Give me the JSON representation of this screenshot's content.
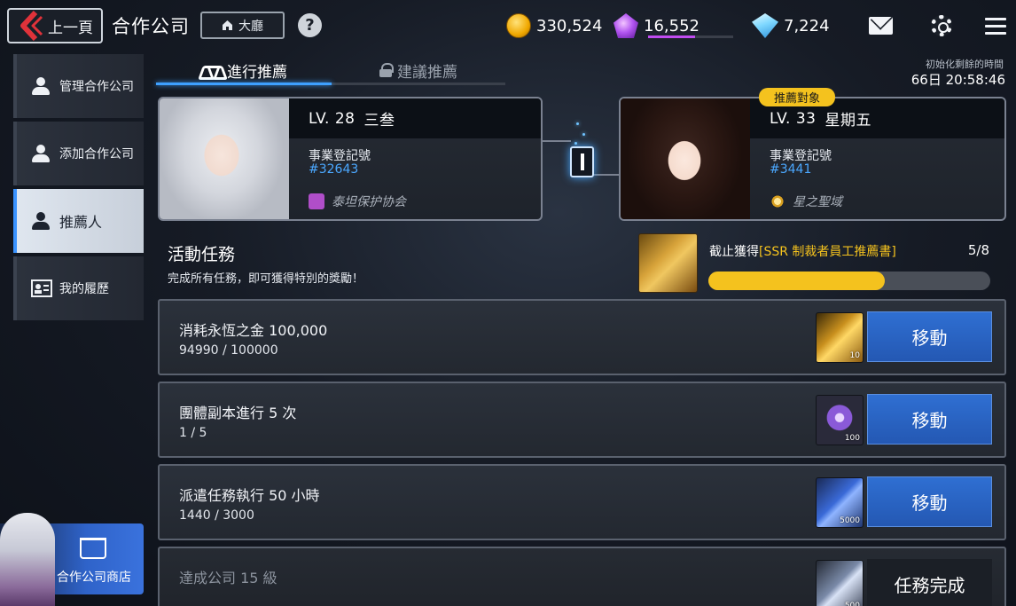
{
  "header": {
    "back_label": "上一頁",
    "title": "合作公司",
    "lobby_label": "大廳",
    "help_glyph": "?"
  },
  "currencies": {
    "gold": "330,524",
    "purple": "16,552",
    "purple_bar_fill_pct": 55,
    "blue": "7,224"
  },
  "sidebar": {
    "items": [
      {
        "label": "管理合作公司",
        "icon": "users-icon"
      },
      {
        "label": "添加合作公司",
        "icon": "add-user-icon"
      },
      {
        "label": "推薦人",
        "icon": "handshake-user-icon",
        "active": true
      },
      {
        "label": "我的履歷",
        "icon": "resume-icon"
      }
    ],
    "shop_label": "合作公司商店"
  },
  "tabs": [
    {
      "label": "進行推薦",
      "active": true
    },
    {
      "label": "建議推薦",
      "locked": true
    }
  ],
  "reset": {
    "label": "初始化剩餘的時間",
    "time": "66日 20:58:46"
  },
  "cards": {
    "left": {
      "level": "LV. 28",
      "name": "三叁",
      "reg_label": "事業登記號",
      "reg_number": "#32643",
      "guild": "泰坦保护协会"
    },
    "right": {
      "badge": "推薦對象",
      "level": "LV. 33",
      "name": "星期五",
      "reg_label": "事業登記號",
      "reg_number": "#3441",
      "guild": "星之聖域"
    }
  },
  "activity": {
    "title": "活動任務",
    "subtitle": "完成所有任務，即可獲得特別的獎勵！",
    "reward_prefix": "截止獲得",
    "reward_name": "[SSR 制裁者員工推薦書]",
    "reward_count": "5/8",
    "reward_progress": 0.625
  },
  "missions": [
    {
      "title": "消耗永恆之金 100,000",
      "progress": "94990 / 100000",
      "item_qty": "10",
      "item": "gold-card-icon",
      "button": "移動",
      "done": false
    },
    {
      "title": "團體副本進行 5 次",
      "progress": "1 / 5",
      "item_qty": "100",
      "item": "chip-icon",
      "button": "移動",
      "done": false
    },
    {
      "title": "派遣任務執行 50 小時",
      "progress": "1440 / 3000",
      "item_qty": "5000",
      "item": "book-icon",
      "button": "移動",
      "done": false
    },
    {
      "title": "達成公司 15 級",
      "progress": "",
      "item_qty": "500",
      "item": "crystal-icon",
      "button": "任務完成",
      "done": true
    }
  ],
  "colors": {
    "accent_blue": "#3ea0ff",
    "button_blue": "#2f6fd2",
    "highlight_yellow": "#f4c21e"
  }
}
